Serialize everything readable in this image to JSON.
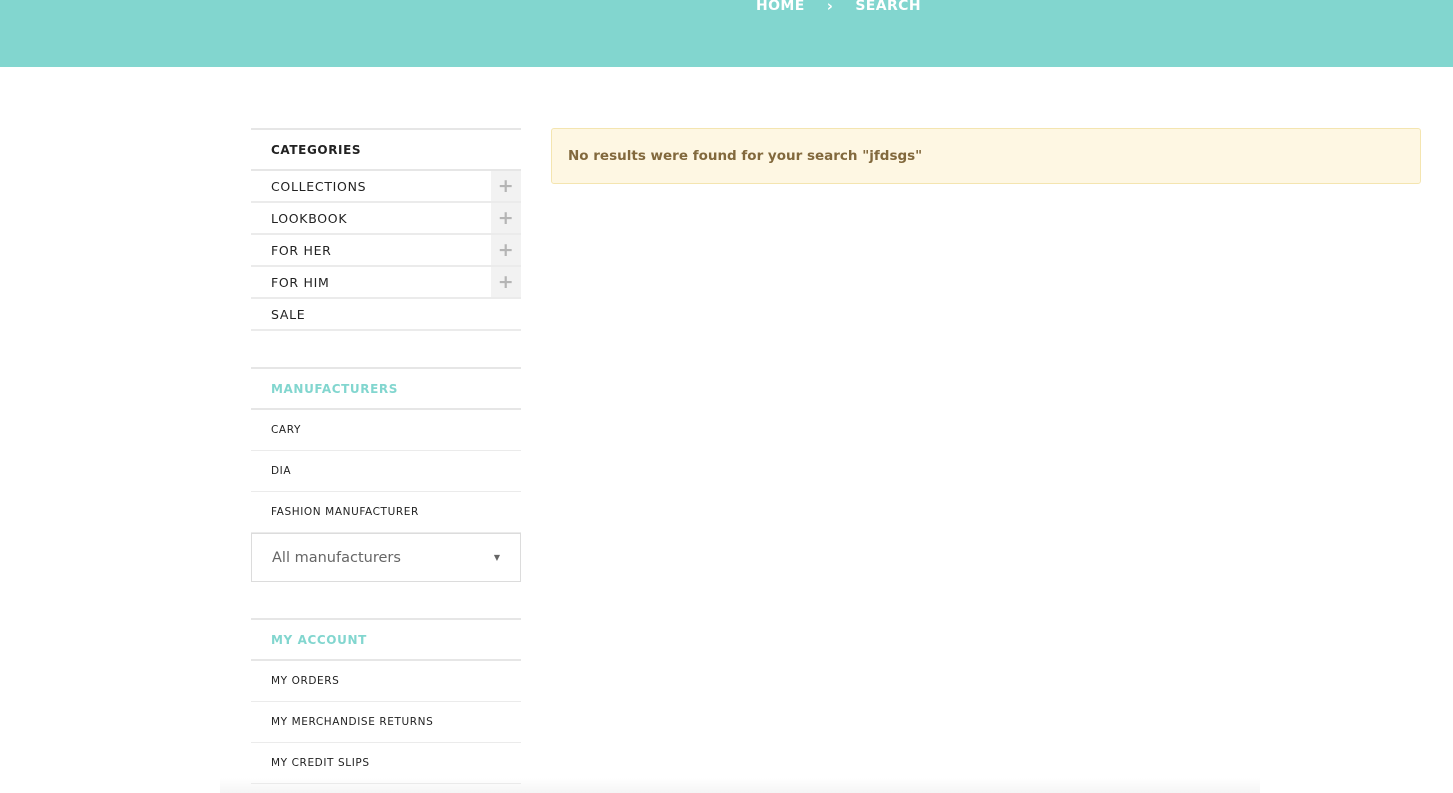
{
  "breadcrumb": {
    "home": "HOME",
    "separator": "›",
    "current": "SEARCH"
  },
  "colors": {
    "topbar": "#82d6cf",
    "accent": "#82d6cf",
    "alert_bg": "#fef7e3",
    "alert_text": "#82693d"
  },
  "categories": {
    "title": "CATEGORIES",
    "items": [
      {
        "label": "COLLECTIONS",
        "expand_icon": "plus-icon"
      },
      {
        "label": "LOOKBOOK",
        "expand_icon": "plus-icon"
      },
      {
        "label": "FOR HER",
        "expand_icon": "plus-icon"
      },
      {
        "label": "FOR HIM",
        "expand_icon": "plus-icon"
      },
      {
        "label": "SALE"
      }
    ]
  },
  "manufacturers": {
    "title": "MANUFACTURERS",
    "items": [
      "CARY",
      "DIA",
      "FASHION MANUFACTURER"
    ],
    "select_value": "All manufacturers"
  },
  "my_account": {
    "title": "MY ACCOUNT",
    "items": [
      "MY ORDERS",
      "MY MERCHANDISE RETURNS",
      "MY CREDIT SLIPS"
    ]
  },
  "search": {
    "no_results_message": "No results were found for your search \"jfdsgs\""
  }
}
